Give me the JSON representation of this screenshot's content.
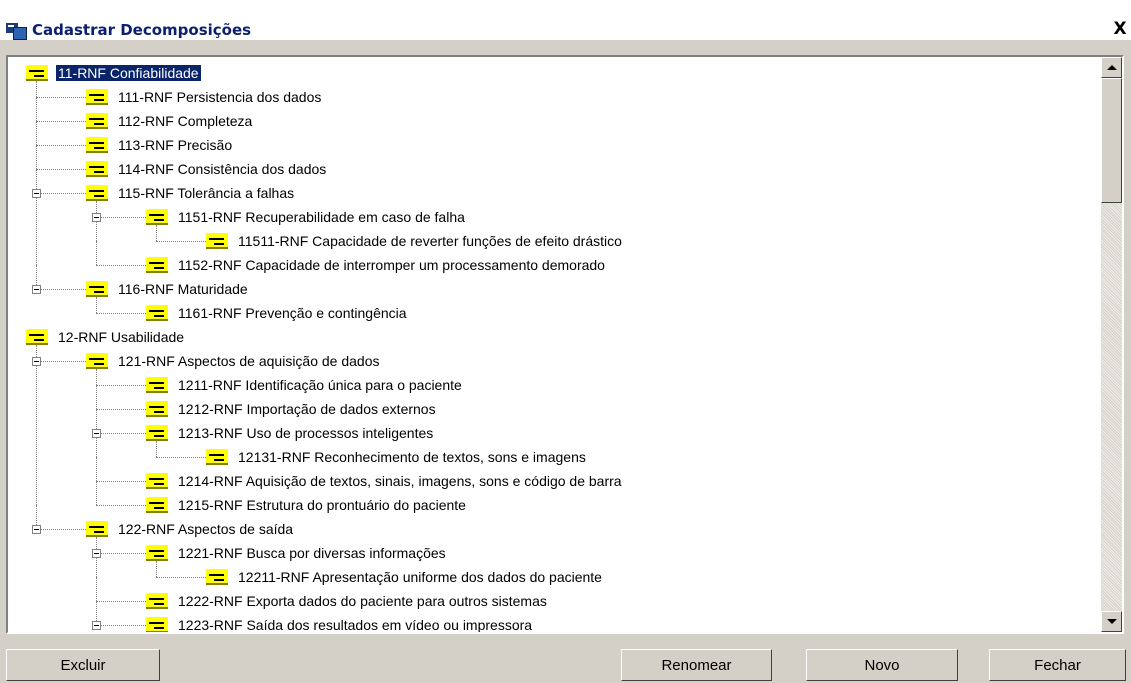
{
  "window": {
    "title": "Cadastrar Decomposições",
    "close_symbol": "X"
  },
  "tree": {
    "nodes": [
      {
        "label": "11-RNF Confiabilidade",
        "level": 0,
        "selected": true
      },
      {
        "label": "111-RNF Persistencia dos dados",
        "level": 1
      },
      {
        "label": "112-RNF Completeza",
        "level": 1
      },
      {
        "label": "113-RNF Precisão",
        "level": 1
      },
      {
        "label": "114-RNF Consistência dos dados",
        "level": 1
      },
      {
        "label": "115-RNF Tolerância a falhas",
        "level": 1,
        "expanded": true
      },
      {
        "label": "1151-RNF Recuperabilidade em caso de falha",
        "level": 2,
        "expanded": true
      },
      {
        "label": "11511-RNF Capacidade de reverter funções de efeito drástico",
        "level": 3
      },
      {
        "label": "1152-RNF Capacidade de interromper um processamento demorado",
        "level": 2
      },
      {
        "label": "116-RNF Maturidade",
        "level": 1,
        "expanded": true
      },
      {
        "label": "1161-RNF Prevenção e contingência",
        "level": 2
      },
      {
        "label": "12-RNF Usabilidade",
        "level": 0
      },
      {
        "label": "121-RNF Aspectos de aquisição de dados",
        "level": 1,
        "expanded": true
      },
      {
        "label": "1211-RNF Identificação única para o paciente",
        "level": 2
      },
      {
        "label": "1212-RNF Importação de dados externos",
        "level": 2
      },
      {
        "label": "1213-RNF Uso de processos inteligentes",
        "level": 2,
        "expanded": true
      },
      {
        "label": "12131-RNF Reconhecimento de textos, sons e imagens",
        "level": 3
      },
      {
        "label": "1214-RNF Aquisição de textos, sinais, imagens, sons e código de barra",
        "level": 2
      },
      {
        "label": "1215-RNF Estrutura do prontuário do paciente",
        "level": 2
      },
      {
        "label": "122-RNF Aspectos de saída",
        "level": 1,
        "expanded": true
      },
      {
        "label": "1221-RNF Busca por diversas informações",
        "level": 2,
        "expanded": true
      },
      {
        "label": "12211-RNF Apresentação uniforme dos dados do paciente",
        "level": 3
      },
      {
        "label": "1222-RNF Exporta dados do paciente para outros sistemas",
        "level": 2
      },
      {
        "label": "1223-RNF Saída dos resultados em vídeo ou impressora",
        "level": 2,
        "expanded": true
      }
    ]
  },
  "buttons": {
    "excluir": "Excluir",
    "renomear": "Renomear",
    "novo": "Novo",
    "fechar": "Fechar"
  },
  "colors": {
    "selection": "#0a246a",
    "node_icon": "#ffff00",
    "title_text": "#0a1f6e",
    "face": "#d4d0c8"
  }
}
